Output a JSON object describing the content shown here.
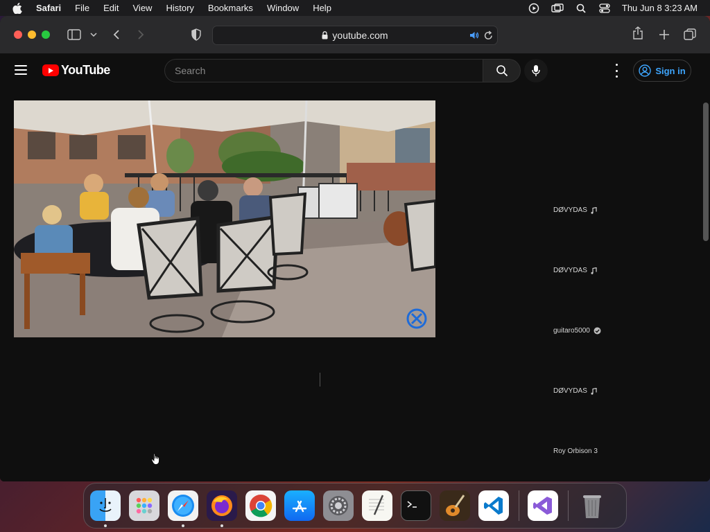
{
  "menubar": {
    "app_name": "Safari",
    "items": [
      "File",
      "Edit",
      "View",
      "History",
      "Bookmarks",
      "Window",
      "Help"
    ],
    "clock": "Thu Jun 8  3:23 AM"
  },
  "browser": {
    "url": "youtube.com"
  },
  "youtube": {
    "logo_text": "YouTube",
    "search_placeholder": "Search",
    "sign_in_label": "Sign in"
  },
  "sidebar": {
    "channels": [
      {
        "name": "DØVYDAS",
        "badge": "music-note-icon"
      },
      {
        "name": "DØVYDAS",
        "badge": "music-note-icon"
      },
      {
        "name": "guitaro5000",
        "badge": "verified-check-icon"
      },
      {
        "name": "DØVYDAS",
        "badge": "music-note-icon"
      },
      {
        "name": "Roy Orbison 3",
        "badge": ""
      }
    ]
  },
  "dock": {
    "apps": [
      "Finder",
      "Launchpad",
      "Safari",
      "Firefox",
      "Chrome",
      "App Store",
      "System Settings",
      "TextEdit",
      "Terminal",
      "GarageBand",
      "Visual Studio Code",
      "Visual Studio",
      "Trash"
    ]
  },
  "colors": {
    "youtube_red": "#ff0000",
    "sign_in_blue": "#3ea6ff",
    "page_bg": "#0f0f0f"
  }
}
